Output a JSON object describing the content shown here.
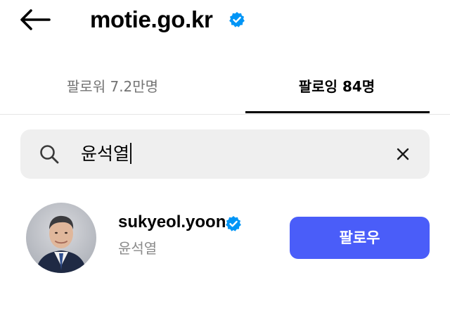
{
  "header": {
    "title": "motie.go.kr",
    "back_icon": "arrow-left-icon",
    "verified_icon": "verified-badge-icon"
  },
  "tabs": [
    {
      "label": "팔로워 7.2만명",
      "active": false
    },
    {
      "label": "팔로잉 84명",
      "active": true
    }
  ],
  "search": {
    "value": "윤석열",
    "icon": "search-icon",
    "clear_icon": "close-icon"
  },
  "results": [
    {
      "username": "sukyeol.yoon",
      "full_name": "윤석열",
      "verified": true,
      "button_label": "팔로우"
    }
  ],
  "colors": {
    "accent": "#4a5df9",
    "verified": "#0095f6",
    "muted_text": "#737373",
    "search_bg": "#efefef"
  }
}
